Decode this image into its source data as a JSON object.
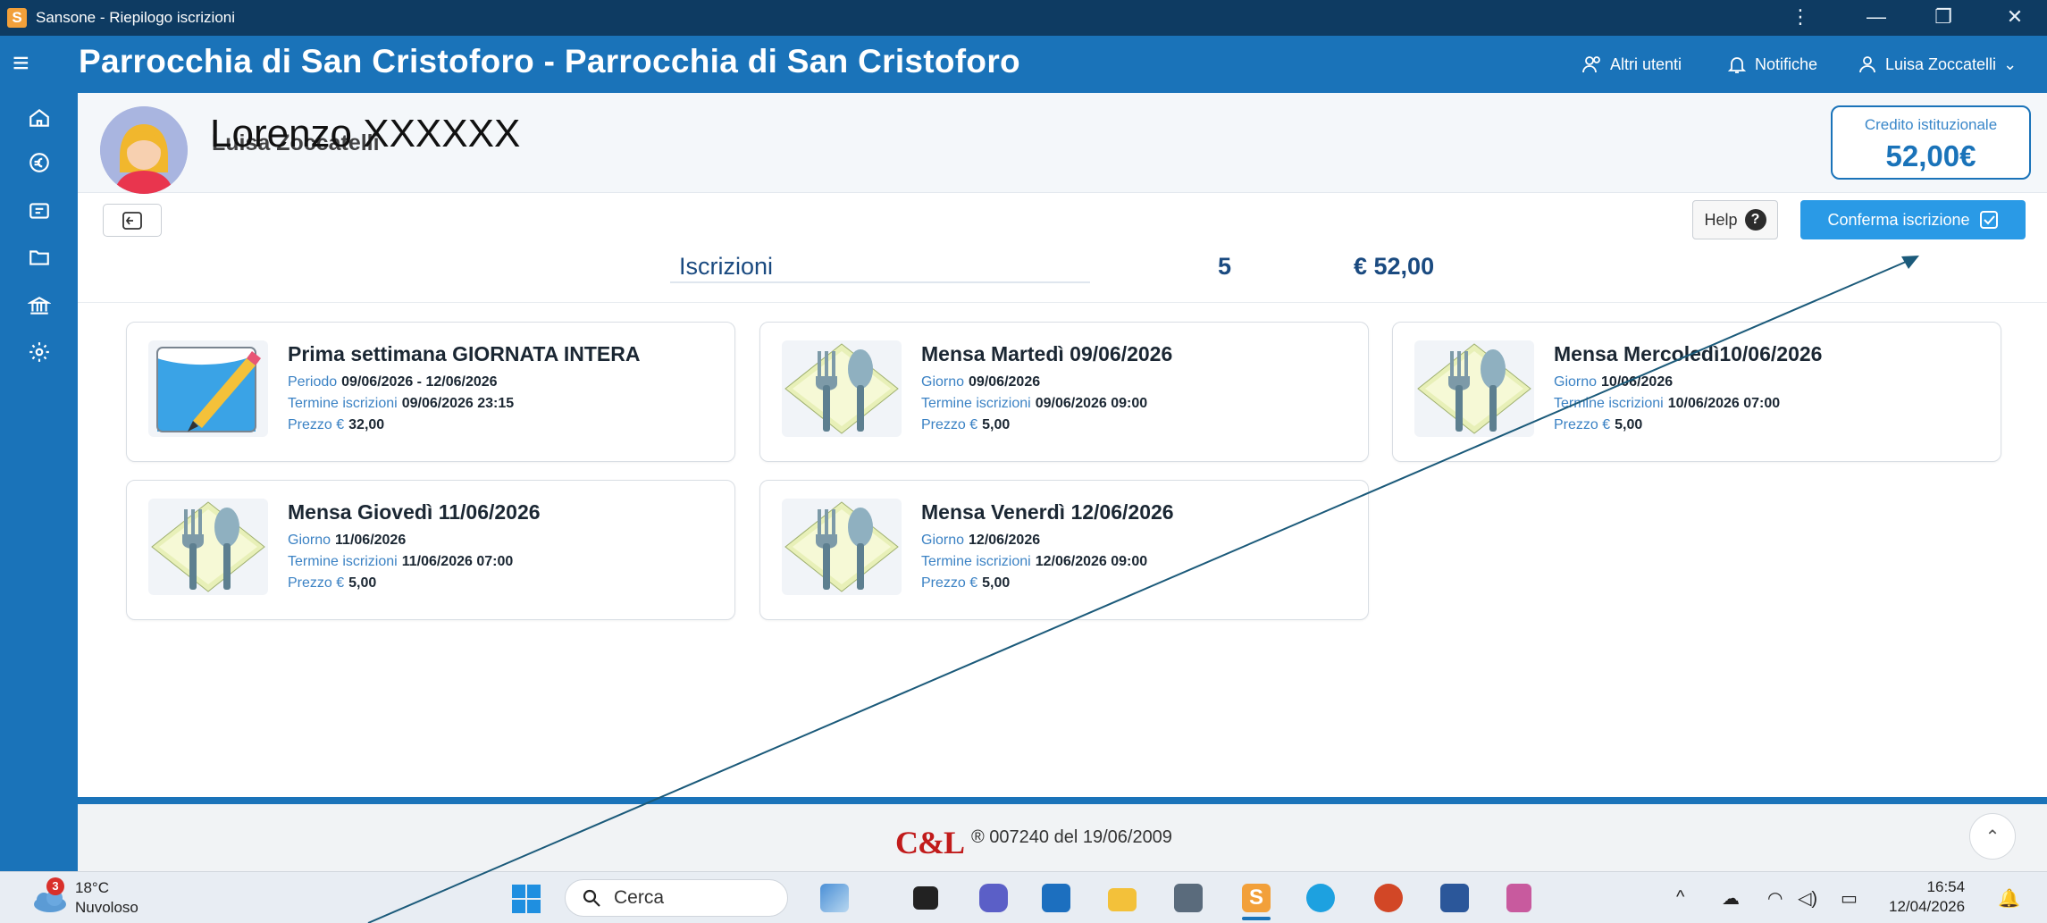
{
  "window": {
    "title": "Sansone - Riepilogo iscrizioni",
    "app_icon": "S"
  },
  "header": {
    "title": "Parrocchia di San Cristoforo - Parrocchia di San Cristoforo",
    "others_label": "Altri utenti",
    "notifications_label": "Notifiche",
    "user_label": "Luisa Zoccatelli"
  },
  "profile": {
    "name": "Lorenzo XXXXXX",
    "overlay_name": "Luisa Zoccatelli",
    "credit_label": "Credito istituzionale",
    "credit_value": "52,00€"
  },
  "toolbar": {
    "help_label": "Help",
    "confirm_label": "Conferma iscrizione"
  },
  "summary": {
    "label": "Iscrizioni",
    "count": "5",
    "total": "€ 52,00"
  },
  "cards": [
    {
      "title": "Prima settimana GIORNATA INTERA",
      "l1": "Periodo",
      "v1": "09/06/2026 - 12/06/2026",
      "l2": "Termine iscrizioni",
      "v2": "09/06/2026 23:15",
      "l3": "Prezzo €",
      "v3": "32,00",
      "icon": "pencil-notepad-icon"
    },
    {
      "title": "Mensa Martedì 09/06/2026",
      "l1": "Giorno",
      "v1": "09/06/2026",
      "l2": "Termine iscrizioni",
      "v2": "09/06/2026 09:00",
      "l3": "Prezzo €",
      "v3": "5,00",
      "icon": "cutlery-icon"
    },
    {
      "title": "Mensa Mercoledì10/06/2026",
      "l1": "Giorno",
      "v1": "10/06/2026",
      "l2": "Termine iscrizioni",
      "v2": "10/06/2026 07:00",
      "l3": "Prezzo €",
      "v3": "5,00",
      "icon": "cutlery-icon"
    },
    {
      "title": "Mensa Giovedì 11/06/2026",
      "l1": "Giorno",
      "v1": "11/06/2026",
      "l2": "Termine iscrizioni",
      "v2": "11/06/2026 07:00",
      "l3": "Prezzo €",
      "v3": "5,00",
      "icon": "cutlery-icon"
    },
    {
      "title": "Mensa Venerdì 12/06/2026",
      "l1": "Giorno",
      "v1": "12/06/2026",
      "l2": "Termine iscrizioni",
      "v2": "12/06/2026 09:00",
      "l3": "Prezzo €",
      "v3": "5,00",
      "icon": "cutlery-icon"
    }
  ],
  "footer": {
    "logo": "C&L",
    "registration": "® 007240 del 19/06/2009"
  },
  "taskbar": {
    "weather_temp": "18°C",
    "weather_cond": "Nuvoloso",
    "weather_badge": "3",
    "search_placeholder": "Cerca",
    "time": "16:54",
    "date": "12/04/2026"
  },
  "colors": {
    "primary": "#1a73b9",
    "titlebar": "#0e3b62",
    "confirm": "#2a9ae6",
    "annotation_arrow": "#1b5a7a"
  }
}
